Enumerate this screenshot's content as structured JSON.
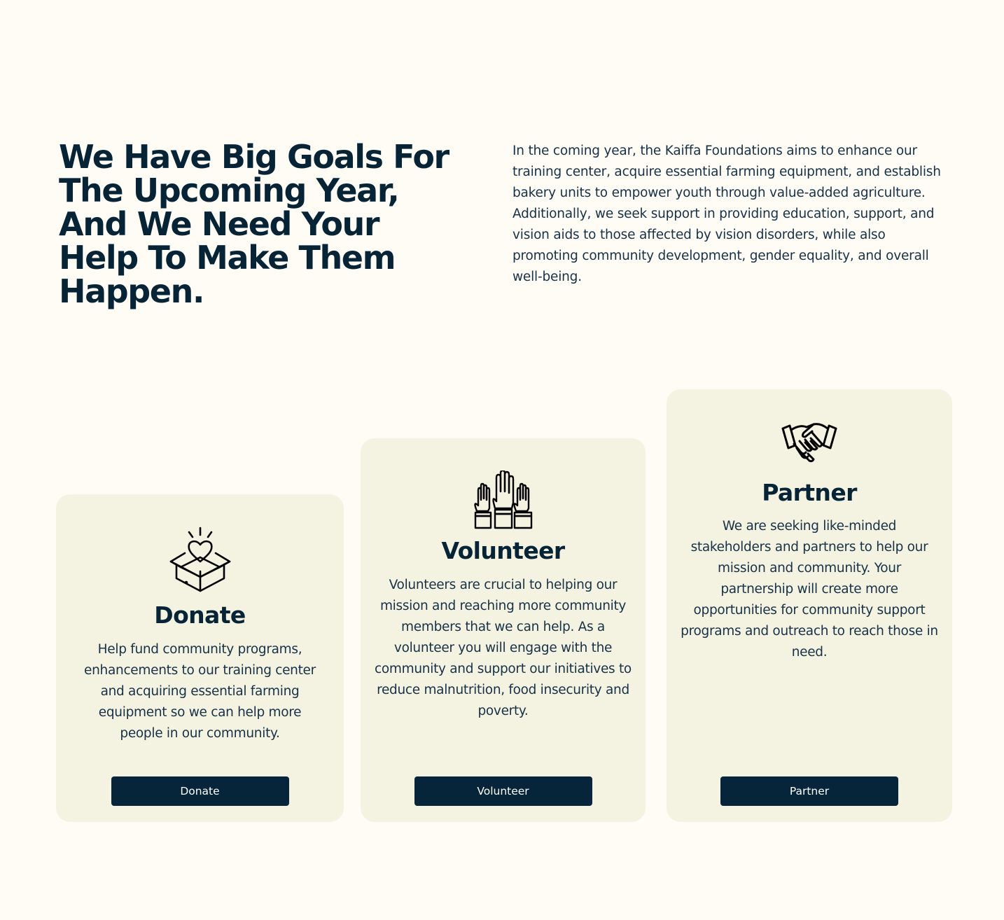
{
  "hero": {
    "headline": "We Have Big Goals For The Upcoming Year, And We Need Your Help To Make Them Happen.",
    "intro": "In the coming year, the Kaiffa Foundations aims to enhance our training center, acquire essential farming equipment, and establish bakery units to empower youth through value-added agriculture. Additionally, we seek support in providing education, support, and vision aids to those affected by vision disorders, while also promoting community development, gender equality, and overall well-being."
  },
  "cards": [
    {
      "icon": "gift-box-heart-icon",
      "title": "Donate",
      "description": "Help fund community programs, enhancements to our training center and acquiring essential farming equipment so we can help more people in our community.",
      "button_label": "Donate"
    },
    {
      "icon": "raised-hands-icon",
      "title": "Volunteer",
      "description": "Volunteers are crucial to helping our mission and reaching more community members that we can help. As a volunteer you will engage with the community and support our initiatives to reduce malnutrition, food insecurity and poverty.",
      "button_label": "Volunteer"
    },
    {
      "icon": "handshake-icon",
      "title": "Partner",
      "description": "We are seeking like-minded stakeholders and partners to help our mission and community. Your partnership will create more opportunities for community support programs and outreach to reach those in need.",
      "button_label": "Partner"
    }
  ],
  "colors": {
    "background": "#fefcf5",
    "card": "#f4f2e1",
    "text": "#072437",
    "button": "#06243a"
  }
}
